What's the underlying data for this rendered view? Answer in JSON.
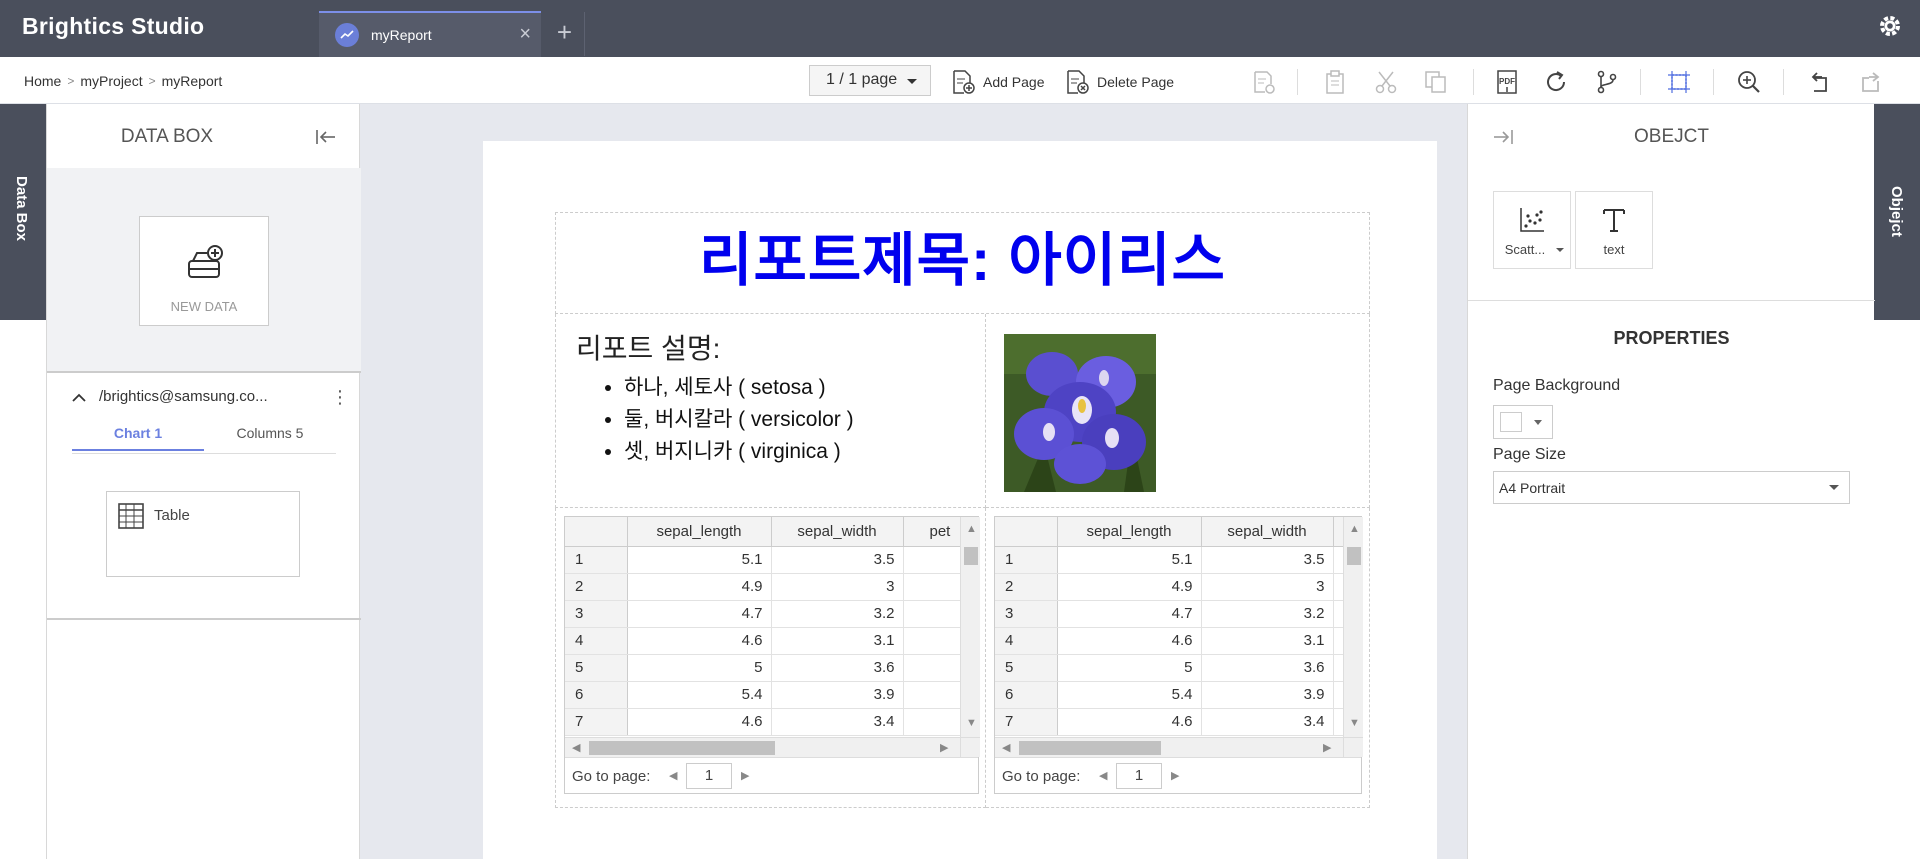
{
  "app": {
    "title": "Brightics Studio"
  },
  "tabs": [
    {
      "label": "myReport"
    }
  ],
  "breadcrumb": [
    "Home",
    "myProject",
    "myReport"
  ],
  "toolbar": {
    "page_indicator": "1 / 1 page",
    "add_page": "Add Page",
    "delete_page": "Delete Page",
    "pdf": "PDF"
  },
  "side_tabs": {
    "left": "Data Box",
    "right": "Objejct"
  },
  "databox": {
    "title": "DATA BOX",
    "new_data": "NEW DATA",
    "source_path": "/brightics@samsung.co...",
    "tabs": [
      "Chart 1",
      "Columns 5"
    ],
    "card_label": "Table"
  },
  "report": {
    "title": "리포트제목: 아이리스",
    "desc_heading": "리포트 설명:",
    "items": [
      "하나, 세토사 ( setosa )",
      "둘, 버시칼라 ( versicolor )",
      "셋, 버지니카 ( virginica )"
    ]
  },
  "grid_left": {
    "columns": [
      "sepal_length",
      "sepal_width",
      "pet"
    ],
    "rows": [
      [
        "1",
        "5.1",
        "3.5"
      ],
      [
        "2",
        "4.9",
        "3"
      ],
      [
        "3",
        "4.7",
        "3.2"
      ],
      [
        "4",
        "4.6",
        "3.1"
      ],
      [
        "5",
        "5",
        "3.6"
      ],
      [
        "6",
        "5.4",
        "3.9"
      ],
      [
        "7",
        "4.6",
        "3.4"
      ]
    ],
    "goto_label": "Go to page:",
    "page": "1"
  },
  "grid_right": {
    "columns": [
      "sepal_length",
      "sepal_width"
    ],
    "rows": [
      [
        "1",
        "5.1",
        "3.5"
      ],
      [
        "2",
        "4.9",
        "3"
      ],
      [
        "3",
        "4.7",
        "3.2"
      ],
      [
        "4",
        "4.6",
        "3.1"
      ],
      [
        "5",
        "5",
        "3.6"
      ],
      [
        "6",
        "5.4",
        "3.9"
      ],
      [
        "7",
        "4.6",
        "3.4"
      ]
    ],
    "goto_label": "Go to page:",
    "page": "1"
  },
  "object_panel": {
    "title": "OBEJCT",
    "cards": [
      {
        "label": "Scatt...",
        "icon": "scatter-icon"
      },
      {
        "label": "text",
        "icon": "text-icon"
      }
    ],
    "properties_title": "PROPERTIES",
    "page_background_label": "Page Background",
    "page_background_value": "#ffffff",
    "page_size_label": "Page Size",
    "page_size_value": "A4 Portrait"
  },
  "colors": {
    "accent": "#6b80e0",
    "title_blue": "#0000ee",
    "topbar": "#4a4f5c"
  }
}
